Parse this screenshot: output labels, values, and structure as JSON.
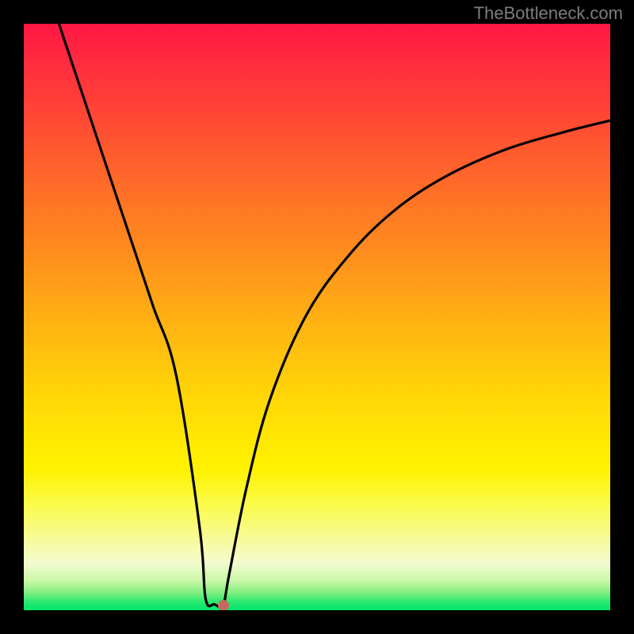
{
  "watermark": "TheBottleneck.com",
  "chart_data": {
    "type": "line",
    "title": "",
    "xlabel": "",
    "ylabel": "",
    "xlim": [
      0,
      100
    ],
    "ylim": [
      0,
      100
    ],
    "grid": false,
    "legend": false,
    "series": [
      {
        "name": "curve",
        "x": [
          6,
          10,
          14,
          18,
          22,
          26,
          30,
          31,
          32.5,
          34,
          35,
          38,
          42,
          48,
          55,
          63,
          72,
          82,
          92,
          100
        ],
        "y": [
          100,
          88,
          76,
          64,
          52,
          40,
          14,
          2,
          1,
          1,
          6,
          21,
          36,
          50,
          60,
          68,
          74,
          78.5,
          81.5,
          83.5
        ]
      }
    ],
    "marker": {
      "x": 34,
      "y": 0.8,
      "color": "#c46a63"
    },
    "background_gradient_stops": [
      {
        "pos": 0,
        "color": "#ff1744"
      },
      {
        "pos": 50,
        "color": "#ffa317"
      },
      {
        "pos": 76,
        "color": "#fff200"
      },
      {
        "pos": 92,
        "color": "#f2fbd0"
      },
      {
        "pos": 100,
        "color": "#00e56a"
      }
    ]
  }
}
